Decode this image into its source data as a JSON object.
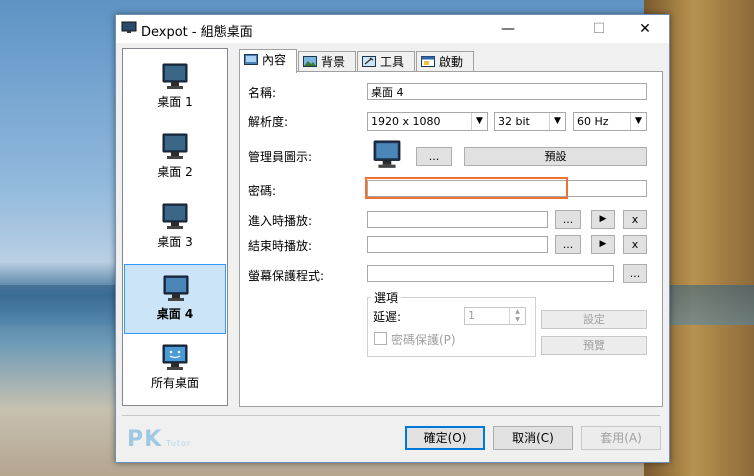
{
  "window": {
    "title": "Dexpot - 組態桌面",
    "minimize": "—",
    "maximize": "☐",
    "close": "✕"
  },
  "nav": [
    {
      "label": "桌面 1",
      "selected": false
    },
    {
      "label": "桌面 2",
      "selected": false
    },
    {
      "label": "桌面 3",
      "selected": false
    },
    {
      "label": "桌面 4",
      "selected": true
    },
    {
      "label": "所有桌面",
      "selected": false
    }
  ],
  "tabs": [
    {
      "label": "內容",
      "active": true,
      "icon": "desktop-icon"
    },
    {
      "label": "背景",
      "active": false,
      "icon": "image-icon"
    },
    {
      "label": "工具",
      "active": false,
      "icon": "tools-icon"
    },
    {
      "label": "啟動",
      "active": false,
      "icon": "window-icon"
    }
  ],
  "form": {
    "name_label": "名稱:",
    "name_value": "桌面 4",
    "resolution_label": "解析度:",
    "resolution_value": "1920 x 1080",
    "depth_value": "32 bit",
    "refresh_value": "60 Hz",
    "admin_icon_label": "管理員圖示:",
    "browse_label": "...",
    "default_label": "預設",
    "password_label": "密碼:",
    "password_value": "",
    "enter_sound_label": "進入時播放:",
    "exit_sound_label": "結束時播放:",
    "screensaver_label": "螢幕保護程式:",
    "play_label": "▶",
    "clear_label": "x"
  },
  "options": {
    "title": "選項",
    "delay_label": "延遲:",
    "delay_value": "1",
    "password_protect_label": "密碼保護(P)",
    "settings_label": "設定",
    "preview_label": "預覽"
  },
  "footer": {
    "ok": "確定(O)",
    "cancel": "取消(C)",
    "apply": "套用(A)"
  },
  "watermark": {
    "text": "PK",
    "sub": "Tutor"
  },
  "colors": {
    "highlight": "#f07030",
    "selection": "#cce4f7",
    "accent": "#0078d7"
  }
}
